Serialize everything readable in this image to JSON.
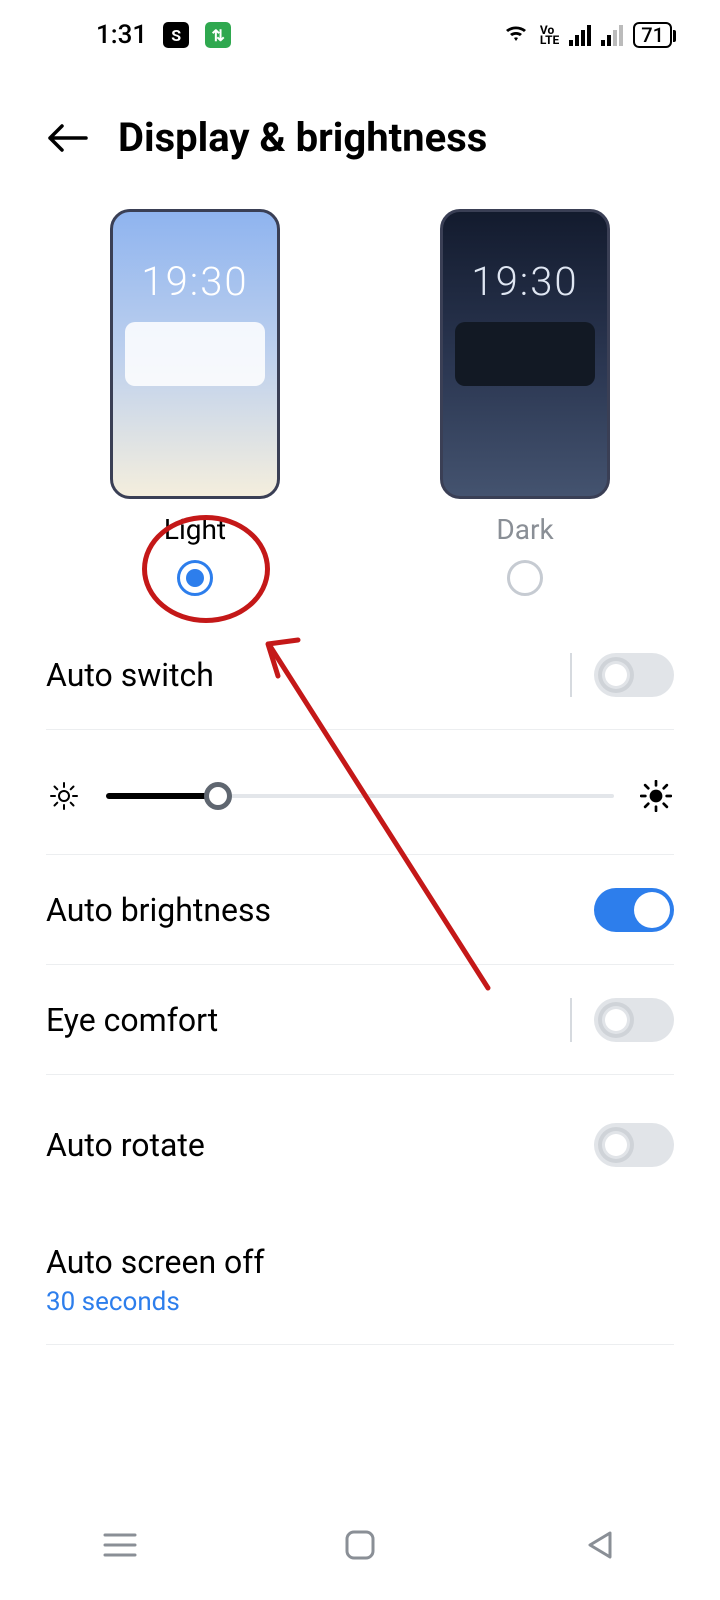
{
  "status": {
    "time": "1:31",
    "battery": "71",
    "volte": "Vo\nLTE"
  },
  "header": {
    "title": "Display & brightness"
  },
  "themes": {
    "preview_clock": "19:30",
    "light": {
      "label": "Light",
      "selected": true
    },
    "dark": {
      "label": "Dark",
      "selected": false
    }
  },
  "rows": {
    "auto_switch": {
      "label": "Auto switch",
      "enabled": false,
      "has_nav": true
    },
    "auto_brightness": {
      "label": "Auto brightness",
      "enabled": true
    },
    "eye_comfort": {
      "label": "Eye comfort",
      "enabled": false,
      "has_nav": true
    },
    "auto_rotate": {
      "label": "Auto rotate",
      "enabled": false
    },
    "auto_screen_off": {
      "label": "Auto screen off",
      "value": "30 seconds"
    }
  },
  "brightness": {
    "percent": 22
  },
  "colors": {
    "accent": "#2d7eec",
    "annotation": "#c41818"
  }
}
